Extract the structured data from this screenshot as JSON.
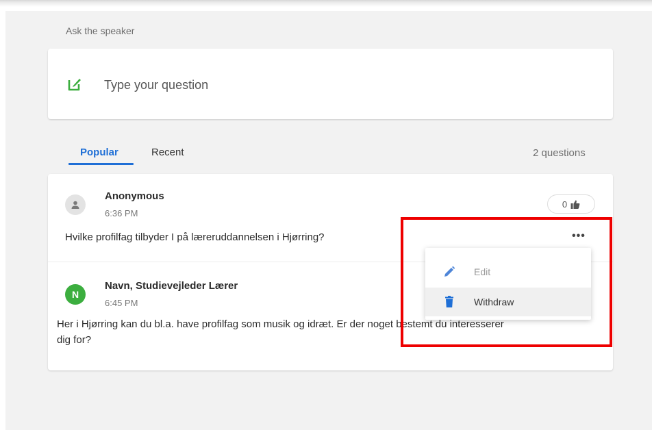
{
  "section_label": "Ask the speaker",
  "ask": {
    "placeholder": "Type your question",
    "icon": "edit-square-icon"
  },
  "tabs": [
    {
      "label": "Popular",
      "active": true
    },
    {
      "label": "Recent",
      "active": false
    }
  ],
  "question_count": "2 questions",
  "questions": [
    {
      "author": "Anonymous",
      "avatar_icon": "person-icon",
      "time": "6:36 PM",
      "text": "Hvilke profilfag tilbyder I på læreruddannelsen i Hjørring?",
      "likes": "0"
    },
    {
      "author": "Navn, Studievejleder Lærer",
      "avatar_initial": "N",
      "time": "6:45 PM",
      "text_line1": "Her i Hjørring kan du bl.a. have profilfag som musik og idræt. Er der noget bestemt du interesserer",
      "text_line2": "dig for?"
    }
  ],
  "menu": {
    "items": [
      {
        "label": "Edit",
        "icon": "pencil-icon",
        "enabled": false
      },
      {
        "label": "Withdraw",
        "icon": "trash-icon",
        "enabled": true
      }
    ]
  },
  "colors": {
    "accent_blue": "#1f6fd6",
    "brand_green": "#3cae3f",
    "highlight_red": "#ee0000"
  }
}
